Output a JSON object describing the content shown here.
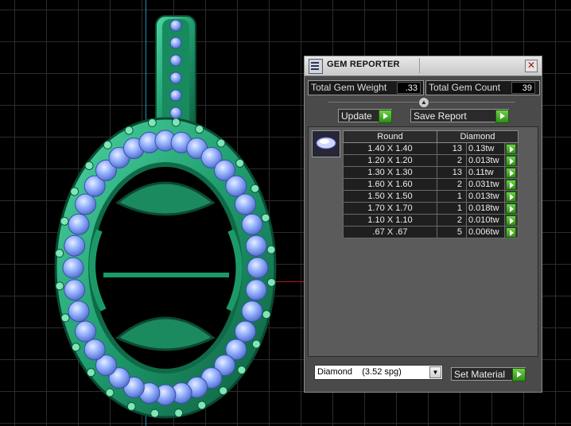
{
  "panel": {
    "title": "GEM REPORTER",
    "close_glyph": "✕",
    "total_weight_label": "Total Gem Weight",
    "total_weight_value": ".33",
    "total_count_label": "Total Gem Count",
    "total_count_value": "39",
    "collapse_glyph": "▲",
    "update_label": "Update",
    "save_report_label": "Save Report",
    "columns": {
      "shape": "Round",
      "material": "Diamond"
    },
    "rows": [
      {
        "size": "1.40 X 1.40",
        "count": "13",
        "weight": "0.13tw"
      },
      {
        "size": "1.20 X 1.20",
        "count": "2",
        "weight": "0.013tw"
      },
      {
        "size": "1.30 X 1.30",
        "count": "13",
        "weight": "0.11tw"
      },
      {
        "size": "1.60 X 1.60",
        "count": "2",
        "weight": "0.031tw"
      },
      {
        "size": "1.50 X 1.50",
        "count": "1",
        "weight": "0.013tw"
      },
      {
        "size": "1.70 X 1.70",
        "count": "1",
        "weight": "0.018tw"
      },
      {
        "size": "1.10 X 1.10",
        "count": "2",
        "weight": "0.010tw"
      },
      {
        "size": ".67 X .67",
        "count": "5",
        "weight": "0.006tw"
      }
    ],
    "material_select_value": "Diamond    (3.52 spg)",
    "dropdown_glyph": "▼",
    "set_material_label": "Set Material"
  },
  "icons": {
    "app": "gem-reporter-icon",
    "close": "close-icon",
    "row_action": "play-arrow-icon",
    "thumbnail": "round-gem-icon"
  },
  "colors": {
    "metal": "#1f9c6e",
    "gem": "#8fb0ff",
    "accent_button": "#3fae22",
    "panel_bg": "#4a4a4a"
  }
}
